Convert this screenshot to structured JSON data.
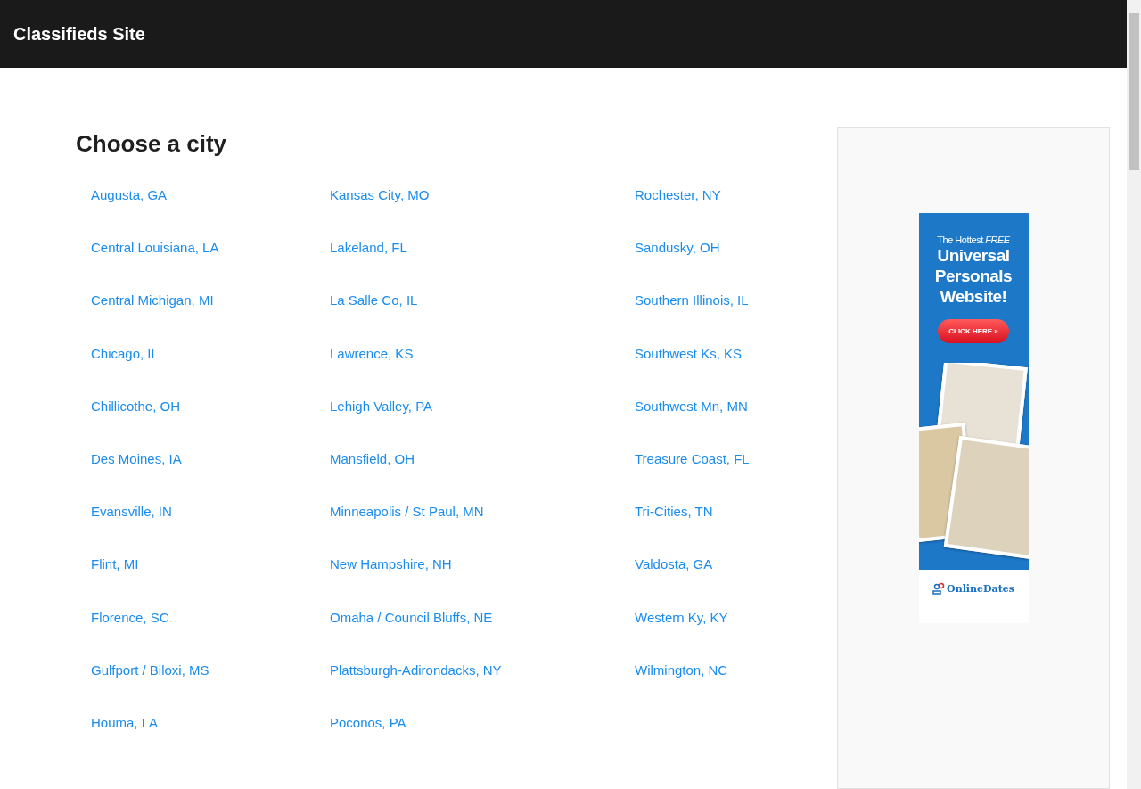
{
  "header": {
    "title": "Classifieds Site"
  },
  "heading": "Choose a city",
  "city_columns": [
    [
      "Augusta, GA",
      "Central Louisiana, LA",
      "Central Michigan, MI",
      "Chicago, IL",
      "Chillicothe, OH",
      "Des Moines, IA",
      "Evansville, IN",
      "Flint, MI",
      "Florence, SC",
      "Gulfport / Biloxi, MS",
      "Houma, LA"
    ],
    [
      "Kansas City, MO",
      "Lakeland, FL",
      "La Salle Co, IL",
      "Lawrence, KS",
      "Lehigh Valley, PA",
      "Mansfield, OH",
      "Minneapolis / St Paul, MN",
      "New Hampshire, NH",
      "Omaha / Council Bluffs, NE",
      "Plattsburgh-Adirondacks, NY",
      "Poconos, PA"
    ],
    [
      "Rochester, NY",
      "Sandusky, OH",
      "Southern Illinois, IL",
      "Southwest Ks, KS",
      "Southwest Mn, MN",
      "Treasure Coast, FL",
      "Tri-Cities, TN",
      "Valdosta, GA",
      "Western Ky, KY",
      "Wilmington, NC"
    ]
  ],
  "ad": {
    "tagline": "The Hottest *FREE*",
    "headline": "Universal Personals Website!",
    "button": "CLICK HERE »",
    "brand": "OnlineDates"
  }
}
